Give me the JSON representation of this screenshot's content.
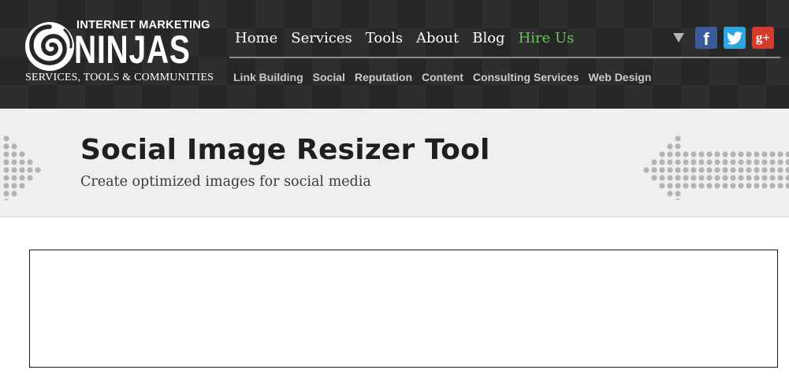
{
  "logo": {
    "line1": "INTERNET MARKETING",
    "line2": "NINJAS",
    "line3": "SERVICES, TOOLS & COMMUNITIES"
  },
  "main_nav": [
    {
      "label": "Home"
    },
    {
      "label": "Services"
    },
    {
      "label": "Tools"
    },
    {
      "label": "About"
    },
    {
      "label": "Blog"
    },
    {
      "label": "Hire Us"
    }
  ],
  "sub_nav": [
    {
      "label": "Link Building"
    },
    {
      "label": "Social"
    },
    {
      "label": "Reputation"
    },
    {
      "label": "Content"
    },
    {
      "label": "Consulting Services"
    },
    {
      "label": "Web Design"
    }
  ],
  "social": {
    "facebook": "f",
    "google_plus": "g+",
    "icons": [
      "chevron-down-icon",
      "facebook-icon",
      "twitter-icon",
      "google-plus-icon"
    ],
    "colors": {
      "facebook": "#3b5b9b",
      "twitter": "#2ea7df",
      "google_plus": "#d43c2c"
    }
  },
  "banner": {
    "title": "Social Image Resizer Tool",
    "subtitle": "Create optimized images for social media"
  },
  "colors": {
    "header_bg": "#262626",
    "accent_green": "#5fcc4f",
    "banner_bg": "#efefef"
  }
}
